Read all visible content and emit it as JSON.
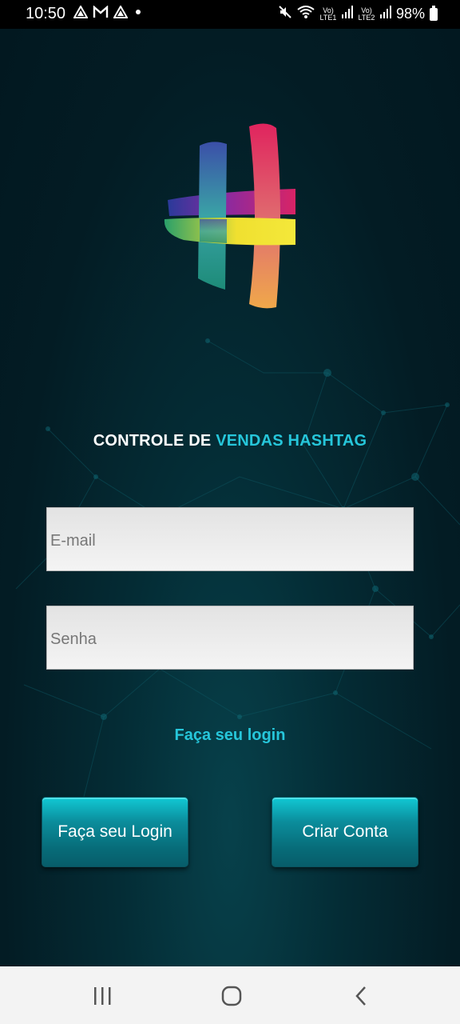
{
  "status_bar": {
    "time": "10:50",
    "notification_icons": [
      "drive-icon",
      "gmail-icon",
      "drive-icon",
      "dot-icon"
    ],
    "signal_label_1": "Vo) LTE1",
    "signal_label_2": "Vo) LTE2",
    "battery": "98%"
  },
  "app": {
    "title_white": "CONTROLE DE ",
    "title_accent": "VENDAS HASHTAG",
    "email": {
      "value": "",
      "placeholder": "E-mail"
    },
    "senha": {
      "value": "",
      "placeholder": "Senha"
    },
    "login_link": "Faça seu login",
    "login_button": "Faça seu Login",
    "criar_button": "Criar Conta",
    "accent_color": "#26c6da",
    "button_color": "#0b8d9c"
  },
  "nav_bar": {
    "buttons": [
      "recents-icon",
      "home-icon",
      "back-icon"
    ]
  }
}
